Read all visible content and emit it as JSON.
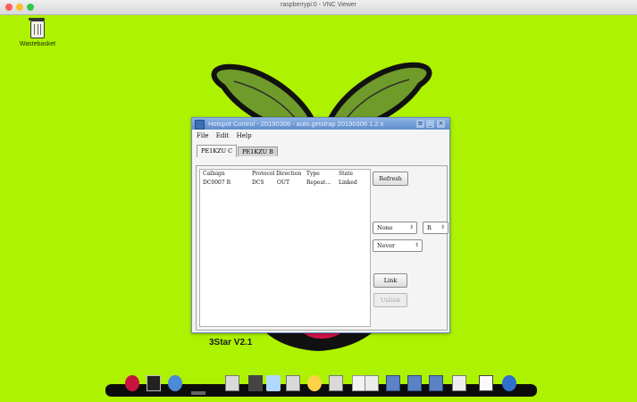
{
  "window": {
    "title": "raspberrypi:0 - VNC Viewer"
  },
  "desktop": {
    "wastebasket_label": "Wastebasket",
    "version_label": "3Star V2.1",
    "background_color": "#adf200"
  },
  "app": {
    "title": "Hotspot Control - 20190306 - auto.getstrap 20190306 1.2 x",
    "menu": [
      "File",
      "Edit",
      "Help"
    ],
    "tabs": [
      "PE1KZU C",
      "PE1KZU B"
    ],
    "columns": [
      "Callsign",
      "Protocol",
      "Direction",
      "Type",
      "State"
    ],
    "rows": [
      {
        "callsign": "DC0007 R",
        "protocol": "DCS",
        "direction": "OUT",
        "type": "Repeat...",
        "state": "Linked"
      }
    ],
    "buttons": {
      "refresh": "Refresh",
      "link": "Link",
      "unlink": "Unlink"
    },
    "selects": {
      "reflector": "None",
      "module": "R",
      "reconnect": "Never"
    }
  },
  "dock_icons": [
    "raspberry-icon",
    "terminal-icon",
    "globe-icon",
    "bar-icon",
    "folder-icon",
    "tools-icon",
    "flask-icon",
    "folder-icon",
    "search-icon",
    "folder-icon",
    "document-icon",
    "image-icon",
    "window-icon",
    "window-icon",
    "window-icon",
    "calendar-icon",
    "monitor-icon",
    "accessibility-icon"
  ]
}
